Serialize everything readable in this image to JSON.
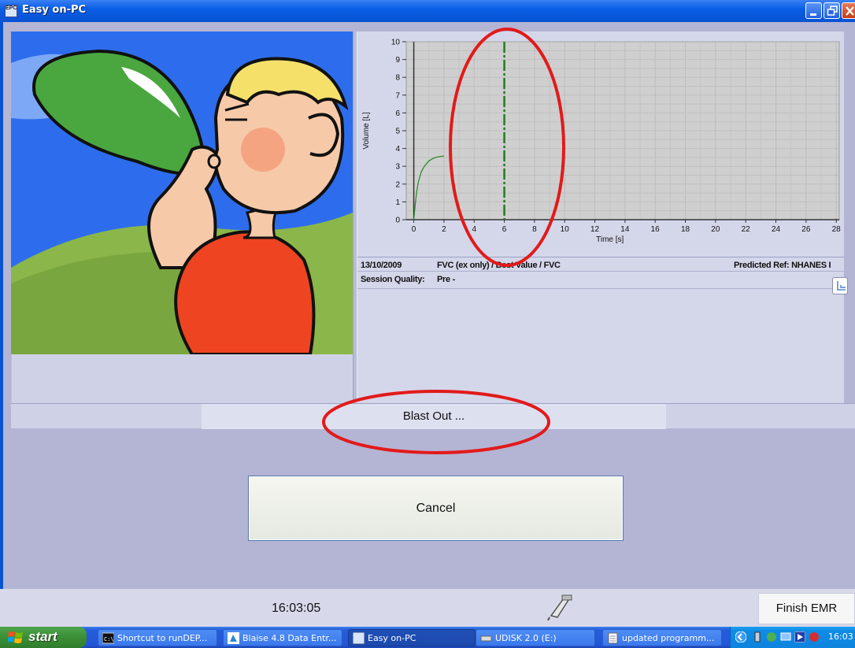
{
  "window": {
    "title": "Easy on-PC",
    "icon_label": "EPC"
  },
  "chart_data": {
    "type": "line",
    "xlabel": "Time [s]",
    "ylabel": "Volume [L]",
    "xlim": [
      -0.5,
      28.2
    ],
    "ylim": [
      0,
      10
    ],
    "x_ticks": [
      0,
      2,
      4,
      6,
      8,
      10,
      12,
      14,
      16,
      18,
      20,
      22,
      24,
      26,
      28
    ],
    "y_ticks": [
      0,
      1,
      2,
      3,
      4,
      5,
      6,
      7,
      8,
      9,
      10
    ],
    "grid": true,
    "series": [
      {
        "x": [
          0,
          0.1,
          0.2,
          0.3,
          0.5,
          0.7,
          1.0,
          1.3,
          1.6,
          2.0
        ],
        "y": [
          0,
          0.9,
          1.6,
          2.1,
          2.7,
          3.0,
          3.3,
          3.45,
          3.53,
          3.58
        ],
        "color": "#2e8b2e"
      }
    ],
    "markers": [
      {
        "x": 0,
        "color": "#333333",
        "style": "solid"
      },
      {
        "x": 6,
        "color": "#1f7f1f",
        "style": "dashdot"
      }
    ]
  },
  "info": {
    "date": "13/10/2009",
    "test": "FVC (ex only) / Best Value / FVC",
    "predicted": "Predicted Ref: NHANES I",
    "session_quality_label": "Session Quality:",
    "session_quality_value": "Pre -"
  },
  "status": {
    "message": "Blast Out ..."
  },
  "actions": {
    "cancel_label": "Cancel",
    "finish_label": "Finish EMR"
  },
  "footer": {
    "clock": "16:03:05"
  },
  "taskbar": {
    "start_label": "start",
    "tasks": [
      {
        "label": "Shortcut to runDEP..."
      },
      {
        "label": "Blaise 4.8 Data Entr..."
      },
      {
        "label": "Easy on-PC"
      },
      {
        "label": "UDISK 2.0 (E:)"
      },
      {
        "label": "updated programm..."
      }
    ],
    "clock": "16:03"
  },
  "colors": {
    "accent_red": "#e21a1a",
    "xp_blue": "#0853d2",
    "panel_bg": "#d4d6ea"
  }
}
